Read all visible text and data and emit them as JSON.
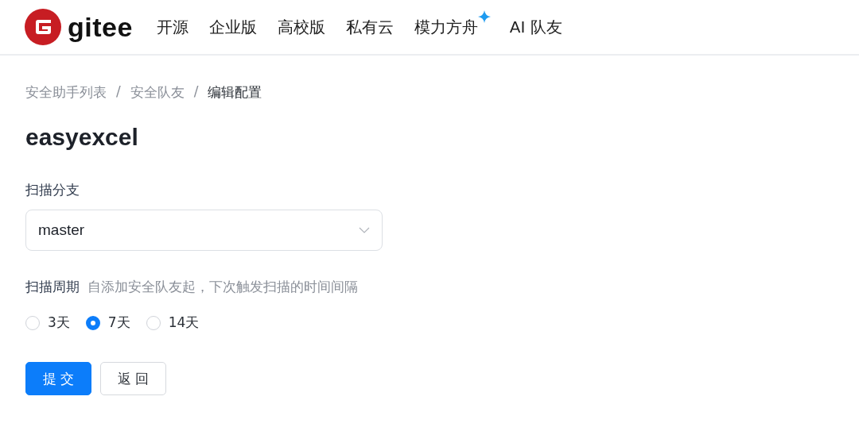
{
  "header": {
    "brand": "gitee",
    "nav": [
      {
        "label": "开源",
        "sparkle": false
      },
      {
        "label": "企业版",
        "sparkle": false
      },
      {
        "label": "高校版",
        "sparkle": false
      },
      {
        "label": "私有云",
        "sparkle": false
      },
      {
        "label": "模力方舟",
        "sparkle": true
      },
      {
        "label": "AI 队友",
        "sparkle": false
      }
    ]
  },
  "breadcrumb": [
    {
      "label": "安全助手列表",
      "kind": "link",
      "current": false
    },
    {
      "label": "/",
      "kind": "separator"
    },
    {
      "label": "安全队友",
      "kind": "link",
      "current": false
    },
    {
      "label": "/",
      "kind": "separator"
    },
    {
      "label": "编辑配置",
      "kind": "link",
      "current": true
    }
  ],
  "title": "easyexcel",
  "branch": {
    "label": "扫描分支",
    "value": "master"
  },
  "period": {
    "label": "扫描周期",
    "hint": "自添加安全队友起，下次触发扫描的时间间隔",
    "options": [
      {
        "label": "3天",
        "selected": false
      },
      {
        "label": "7天",
        "selected": true
      },
      {
        "label": "14天",
        "selected": false
      }
    ]
  },
  "buttons": [
    {
      "label": "提 交",
      "kind": "primary"
    },
    {
      "label": "返 回",
      "kind": "default"
    }
  ]
}
